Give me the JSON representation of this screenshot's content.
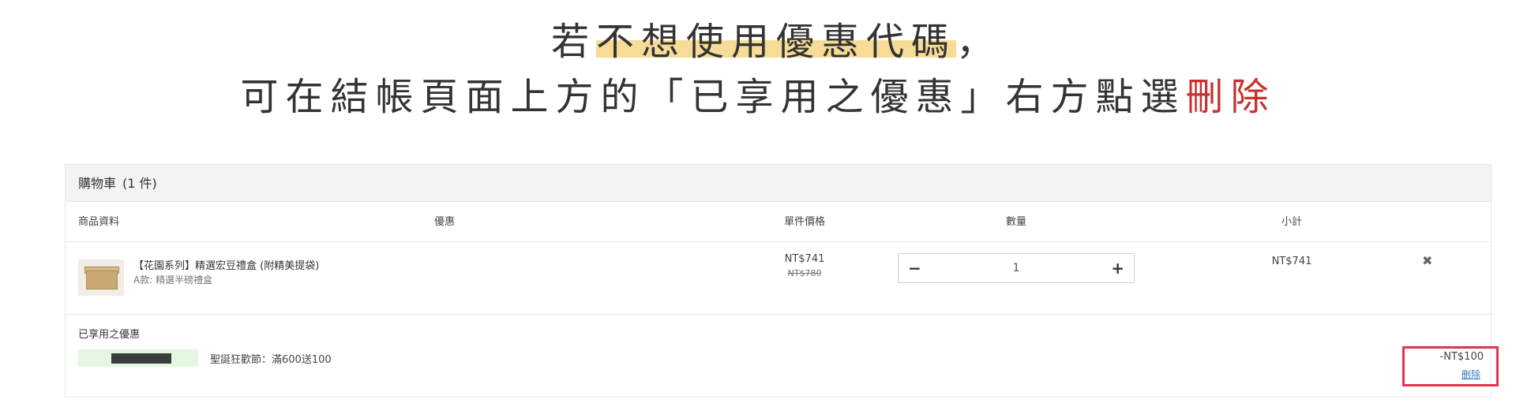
{
  "headline": {
    "line1_prefix": "若",
    "line1_highlight": "不想使用優惠代碼",
    "line1_suffix": "，",
    "line2_text": "可在結帳頁面上方的「已享用之優惠」右方點選",
    "line2_red": "刪除"
  },
  "cart": {
    "title": "購物車",
    "count": "(1 件)",
    "columns": {
      "product": "商品資料",
      "promotion": "優惠",
      "unit_price": "單件價格",
      "quantity": "數量",
      "subtotal": "小計"
    },
    "items": [
      {
        "name": "【花園系列】精選宏豆禮盒 (附精美提袋)",
        "variant": "A款: 精選半磅禮盒",
        "price": "NT$741",
        "original_price": "NT$780",
        "quantity": "1",
        "subtotal": "NT$741"
      }
    ],
    "qty_minus": "−",
    "qty_plus": "+",
    "remove_icon": "✖"
  },
  "promotions": {
    "title": "已享用之優惠",
    "items": [
      {
        "description": "聖誕狂歡節：滿600送100",
        "amount": "-NT$100",
        "delete_label": "刪除"
      }
    ]
  },
  "colors": {
    "highlight": "#f6dc97",
    "accent_red": "#c8302e",
    "link_blue": "#2f78c4",
    "annotation_box": "#e0334c",
    "promo_tag_bg": "#e3f7e1"
  }
}
